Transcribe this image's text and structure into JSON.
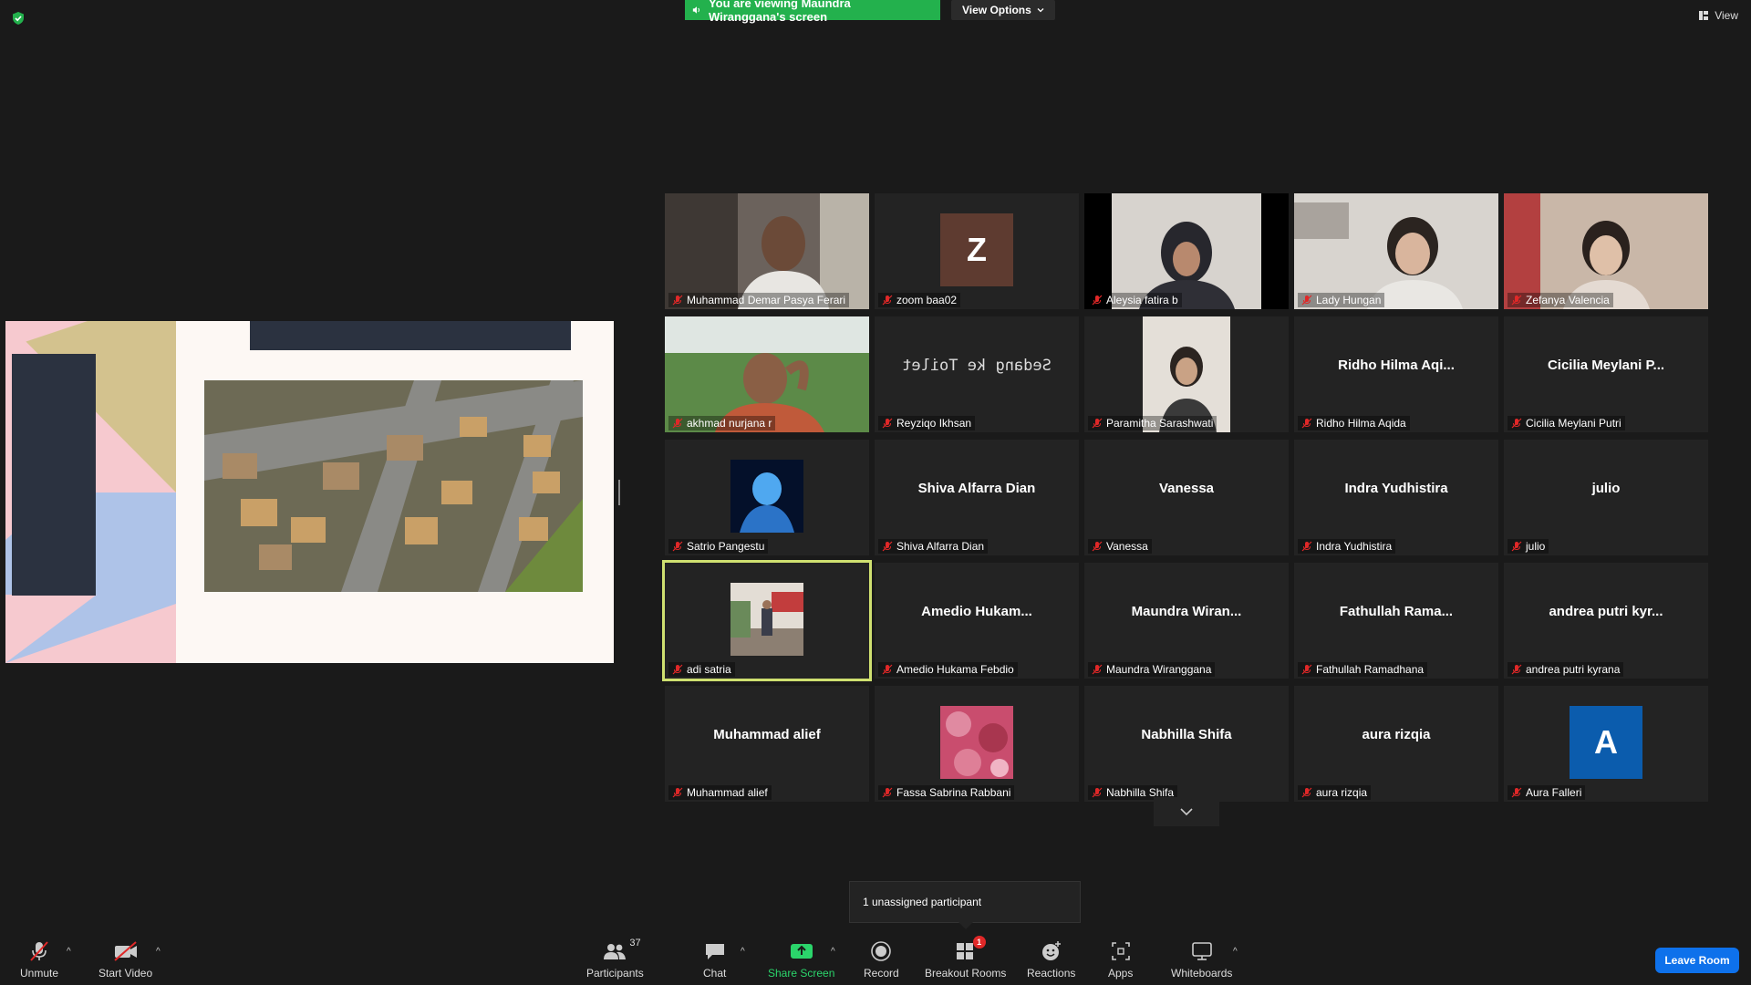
{
  "banner": {
    "viewing_text": "You are viewing Maundra Wiranggana's screen",
    "options_label": "View Options"
  },
  "view_label": "View",
  "participants": [
    {
      "name": "Muhammad Demar Pasya Ferari",
      "display": "video"
    },
    {
      "name": "zoom baa02",
      "display": "letter",
      "letter": "Z",
      "color": "#5e3b30"
    },
    {
      "name": "Aleysia fatira b",
      "display": "video"
    },
    {
      "name": "Lady Hungan",
      "display": "video"
    },
    {
      "name": "Zefanya Valencia",
      "display": "video"
    },
    {
      "name": "akhmad nurjana r",
      "display": "video"
    },
    {
      "name": "Reyziqo Ikhsan",
      "display": "mirror",
      "mirror_text": "Sedang ke Toilet"
    },
    {
      "name": "Paramitha Sarashwati",
      "display": "video-small"
    },
    {
      "name": "Ridho Hilma Aqida",
      "display": "name",
      "big_name": "Ridho Hilma Aqi..."
    },
    {
      "name": "Cicilia Meylani Putri",
      "display": "name",
      "big_name": "Cicilia Meylani P..."
    },
    {
      "name": "Satrio Pangestu",
      "display": "photo",
      "photo": "blue"
    },
    {
      "name": "Shiva Alfarra Dian",
      "display": "name",
      "big_name": "Shiva Alfarra Dian"
    },
    {
      "name": "Vanessa",
      "display": "name",
      "big_name": "Vanessa"
    },
    {
      "name": "Indra Yudhistira",
      "display": "name",
      "big_name": "Indra Yudhistira"
    },
    {
      "name": "julio",
      "display": "name",
      "big_name": "julio"
    },
    {
      "name": "adi satria",
      "display": "photo",
      "photo": "street",
      "active": true
    },
    {
      "name": "Amedio Hukama Febdio",
      "display": "name",
      "big_name": "Amedio  Hukam..."
    },
    {
      "name": "Maundra Wiranggana",
      "display": "name",
      "big_name": "Maundra  Wiran..."
    },
    {
      "name": "Fathullah Ramadhana",
      "display": "name",
      "big_name": "Fathullah  Rama..."
    },
    {
      "name": "andrea putri kyrana",
      "display": "name",
      "big_name": "andrea putri kyr..."
    },
    {
      "name": "Muhammad alief",
      "display": "name",
      "big_name": "Muhammad alief"
    },
    {
      "name": "Fassa Sabrina Rabbani",
      "display": "photo",
      "photo": "pink"
    },
    {
      "name": "Nabhilla Shifa",
      "display": "name",
      "big_name": "Nabhilla Shifa"
    },
    {
      "name": "aura rizqia",
      "display": "name",
      "big_name": "aura rizqia"
    },
    {
      "name": "Aura Falleri",
      "display": "letter",
      "letter": "A",
      "color": "#0b5cad"
    }
  ],
  "tooltip": "1 unassigned participant",
  "toolbar": {
    "unmute": "Unmute",
    "start_video": "Start Video",
    "participants": "Participants",
    "participants_count": "37",
    "chat": "Chat",
    "share_screen": "Share Screen",
    "record": "Record",
    "breakout_rooms": "Breakout Rooms",
    "breakout_badge": "1",
    "reactions": "Reactions",
    "apps": "Apps",
    "whiteboards": "Whiteboards",
    "leave": "Leave Room"
  },
  "colors": {
    "share_green": "#23b14d",
    "active_speaker": "#cfe070",
    "leave_blue": "#0e71eb",
    "mic_red": "#e02828"
  }
}
